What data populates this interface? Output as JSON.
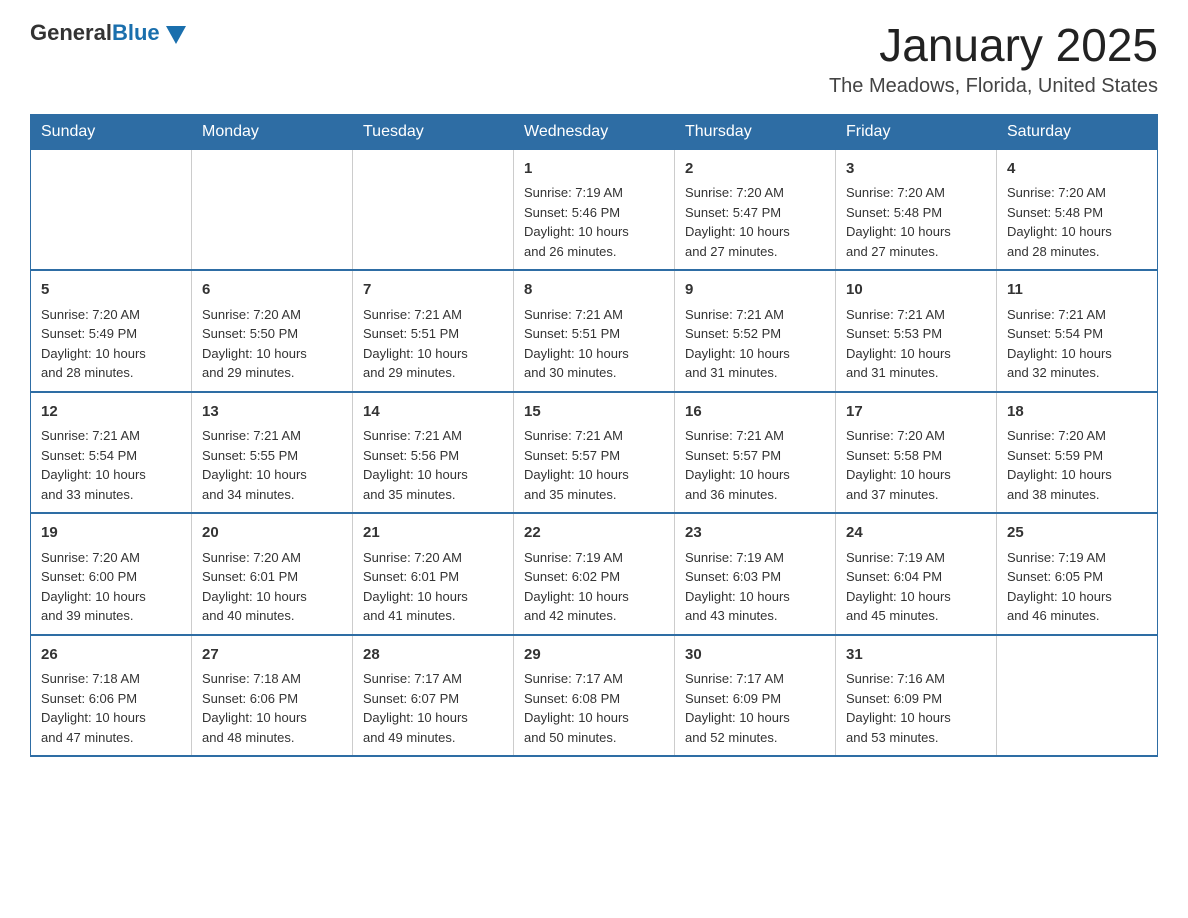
{
  "logo": {
    "general": "General",
    "blue": "Blue"
  },
  "header": {
    "month": "January 2025",
    "location": "The Meadows, Florida, United States"
  },
  "days_of_week": [
    "Sunday",
    "Monday",
    "Tuesday",
    "Wednesday",
    "Thursday",
    "Friday",
    "Saturday"
  ],
  "weeks": [
    [
      {
        "day": "",
        "info": ""
      },
      {
        "day": "",
        "info": ""
      },
      {
        "day": "",
        "info": ""
      },
      {
        "day": "1",
        "info": "Sunrise: 7:19 AM\nSunset: 5:46 PM\nDaylight: 10 hours\nand 26 minutes."
      },
      {
        "day": "2",
        "info": "Sunrise: 7:20 AM\nSunset: 5:47 PM\nDaylight: 10 hours\nand 27 minutes."
      },
      {
        "day": "3",
        "info": "Sunrise: 7:20 AM\nSunset: 5:48 PM\nDaylight: 10 hours\nand 27 minutes."
      },
      {
        "day": "4",
        "info": "Sunrise: 7:20 AM\nSunset: 5:48 PM\nDaylight: 10 hours\nand 28 minutes."
      }
    ],
    [
      {
        "day": "5",
        "info": "Sunrise: 7:20 AM\nSunset: 5:49 PM\nDaylight: 10 hours\nand 28 minutes."
      },
      {
        "day": "6",
        "info": "Sunrise: 7:20 AM\nSunset: 5:50 PM\nDaylight: 10 hours\nand 29 minutes."
      },
      {
        "day": "7",
        "info": "Sunrise: 7:21 AM\nSunset: 5:51 PM\nDaylight: 10 hours\nand 29 minutes."
      },
      {
        "day": "8",
        "info": "Sunrise: 7:21 AM\nSunset: 5:51 PM\nDaylight: 10 hours\nand 30 minutes."
      },
      {
        "day": "9",
        "info": "Sunrise: 7:21 AM\nSunset: 5:52 PM\nDaylight: 10 hours\nand 31 minutes."
      },
      {
        "day": "10",
        "info": "Sunrise: 7:21 AM\nSunset: 5:53 PM\nDaylight: 10 hours\nand 31 minutes."
      },
      {
        "day": "11",
        "info": "Sunrise: 7:21 AM\nSunset: 5:54 PM\nDaylight: 10 hours\nand 32 minutes."
      }
    ],
    [
      {
        "day": "12",
        "info": "Sunrise: 7:21 AM\nSunset: 5:54 PM\nDaylight: 10 hours\nand 33 minutes."
      },
      {
        "day": "13",
        "info": "Sunrise: 7:21 AM\nSunset: 5:55 PM\nDaylight: 10 hours\nand 34 minutes."
      },
      {
        "day": "14",
        "info": "Sunrise: 7:21 AM\nSunset: 5:56 PM\nDaylight: 10 hours\nand 35 minutes."
      },
      {
        "day": "15",
        "info": "Sunrise: 7:21 AM\nSunset: 5:57 PM\nDaylight: 10 hours\nand 35 minutes."
      },
      {
        "day": "16",
        "info": "Sunrise: 7:21 AM\nSunset: 5:57 PM\nDaylight: 10 hours\nand 36 minutes."
      },
      {
        "day": "17",
        "info": "Sunrise: 7:20 AM\nSunset: 5:58 PM\nDaylight: 10 hours\nand 37 minutes."
      },
      {
        "day": "18",
        "info": "Sunrise: 7:20 AM\nSunset: 5:59 PM\nDaylight: 10 hours\nand 38 minutes."
      }
    ],
    [
      {
        "day": "19",
        "info": "Sunrise: 7:20 AM\nSunset: 6:00 PM\nDaylight: 10 hours\nand 39 minutes."
      },
      {
        "day": "20",
        "info": "Sunrise: 7:20 AM\nSunset: 6:01 PM\nDaylight: 10 hours\nand 40 minutes."
      },
      {
        "day": "21",
        "info": "Sunrise: 7:20 AM\nSunset: 6:01 PM\nDaylight: 10 hours\nand 41 minutes."
      },
      {
        "day": "22",
        "info": "Sunrise: 7:19 AM\nSunset: 6:02 PM\nDaylight: 10 hours\nand 42 minutes."
      },
      {
        "day": "23",
        "info": "Sunrise: 7:19 AM\nSunset: 6:03 PM\nDaylight: 10 hours\nand 43 minutes."
      },
      {
        "day": "24",
        "info": "Sunrise: 7:19 AM\nSunset: 6:04 PM\nDaylight: 10 hours\nand 45 minutes."
      },
      {
        "day": "25",
        "info": "Sunrise: 7:19 AM\nSunset: 6:05 PM\nDaylight: 10 hours\nand 46 minutes."
      }
    ],
    [
      {
        "day": "26",
        "info": "Sunrise: 7:18 AM\nSunset: 6:06 PM\nDaylight: 10 hours\nand 47 minutes."
      },
      {
        "day": "27",
        "info": "Sunrise: 7:18 AM\nSunset: 6:06 PM\nDaylight: 10 hours\nand 48 minutes."
      },
      {
        "day": "28",
        "info": "Sunrise: 7:17 AM\nSunset: 6:07 PM\nDaylight: 10 hours\nand 49 minutes."
      },
      {
        "day": "29",
        "info": "Sunrise: 7:17 AM\nSunset: 6:08 PM\nDaylight: 10 hours\nand 50 minutes."
      },
      {
        "day": "30",
        "info": "Sunrise: 7:17 AM\nSunset: 6:09 PM\nDaylight: 10 hours\nand 52 minutes."
      },
      {
        "day": "31",
        "info": "Sunrise: 7:16 AM\nSunset: 6:09 PM\nDaylight: 10 hours\nand 53 minutes."
      },
      {
        "day": "",
        "info": ""
      }
    ]
  ]
}
